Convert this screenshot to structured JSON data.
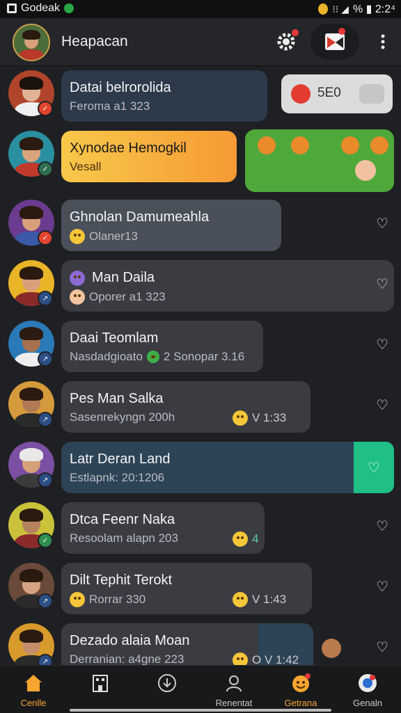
{
  "status_bar": {
    "app": "Godeak",
    "battery": "% ▮ 2:2⁴"
  },
  "header": {
    "title": "Heapacan",
    "icons": [
      "gear-icon",
      "flag-icon",
      "more-icon"
    ]
  },
  "chats": [
    {
      "name": "Datai belrorolida",
      "sub": "Feroma a1 323",
      "pill_value": "5E0"
    },
    {
      "name": "Xynodae Hemogkil",
      "sub": "Vesall"
    },
    {
      "name": "Ghnolan Damumeahla",
      "sub": "Olaner13"
    },
    {
      "name": "Man Daila",
      "sub": "Oporer a1 323"
    },
    {
      "name": "Daai Teomlam",
      "sub": "Nasdadgioato",
      "extra": "2 Sonopar 3.16"
    },
    {
      "name": "Pes Man Salka",
      "sub": "Sasenrekyngn 200h",
      "time": "V 1:33"
    },
    {
      "name": "Latr Deran Land",
      "sub": "Estlapnk: 20:1206"
    },
    {
      "name": "Dtca Feenr Naka",
      "sub": "Resoolam alapn 203",
      "time": "4"
    },
    {
      "name": "Dilt Tephit Terokt",
      "sub": "Rorrar 330",
      "time": "V 1:43"
    },
    {
      "name": "Dezado alaia Moan",
      "sub": "Derranian: a4gne 223",
      "time": "O V 1:42"
    }
  ],
  "bottom_nav": [
    {
      "label": "Cenlle",
      "icon": "home-icon",
      "active": true
    },
    {
      "label": "",
      "icon": "building-icon"
    },
    {
      "label": "",
      "icon": "download-icon"
    },
    {
      "label": "Renentat",
      "icon": "people-icon"
    },
    {
      "label": "Getrana",
      "icon": "emoji-icon"
    },
    {
      "label": "Genaln",
      "icon": "chat-icon"
    }
  ],
  "colors": {
    "accent_orange": "#f6a531",
    "accent_green": "#1fbf86",
    "bg": "#1f2023",
    "bubble": "#3a3c41",
    "highlight": "#2d4356"
  }
}
